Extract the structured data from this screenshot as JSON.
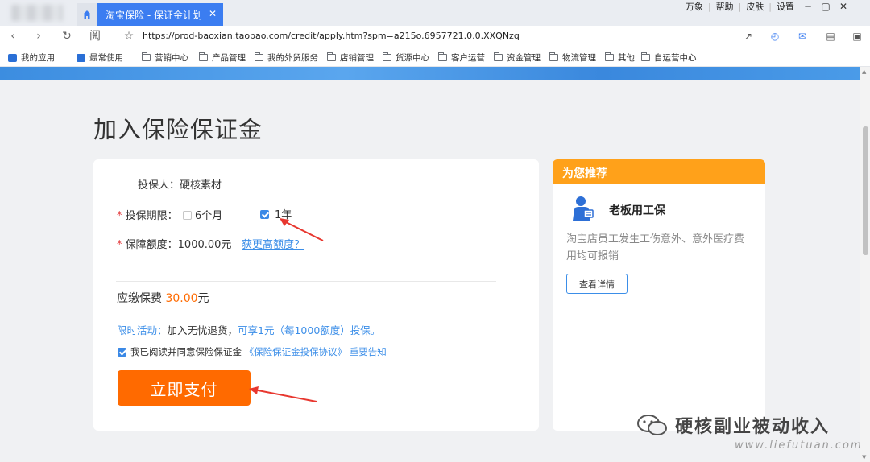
{
  "window": {
    "menu": [
      "万象",
      "帮助",
      "皮肤",
      "设置"
    ],
    "controls": [
      "─",
      "▢",
      "✕"
    ]
  },
  "tab": {
    "title": "淘宝保险 - 保证金计划",
    "close": "✕"
  },
  "address": {
    "url": "https://prod-baoxian.taobao.com/credit/apply.htm?spm=a215o.6957721.0.0.XXQNzq"
  },
  "bookmarks": [
    "我的应用",
    "最常使用",
    "营销中心",
    "产品管理",
    "我的外贸服务",
    "店铺管理",
    "货源中心",
    "客户运营",
    "资金管理",
    "物流管理",
    "其他",
    "自运营中心"
  ],
  "page": {
    "title": "加入保险保证金"
  },
  "form": {
    "insurer_label": "投保人：",
    "insurer_value": "硬核素材",
    "term_label": "投保期限：",
    "term_options": [
      {
        "label": "6个月",
        "checked": false
      },
      {
        "label": "1年",
        "checked": true
      }
    ],
    "coverage_label": "保障额度：",
    "coverage_value": "1000.00元",
    "coverage_link": "获更高额度？",
    "required_mark": "*",
    "premium_label": "应缴保费",
    "premium_value": "30.00",
    "premium_unit": "元",
    "promo_prefix": "限时活动：",
    "promo_text": "加入无忧退货，",
    "promo_highlight": "可享1元（每1000额度）投保。",
    "agree_text": "我已阅读并同意保险保证金",
    "agree_link": "《保险保证金投保协议》",
    "agree_notice": "重要告知",
    "pay_button": "立即支付"
  },
  "recommend": {
    "header": "为您推荐",
    "title": "老板用工保",
    "desc": "淘宝店员工发生工伤意外、意外医疗费用均可报销",
    "button": "查看详情"
  },
  "watermark": {
    "text": "硬核副业被动收入",
    "url": "www.liefutuan.com"
  },
  "colors": {
    "accent": "#3b89e6",
    "orange": "#ff6a00",
    "rec_header": "#ffa11a"
  }
}
